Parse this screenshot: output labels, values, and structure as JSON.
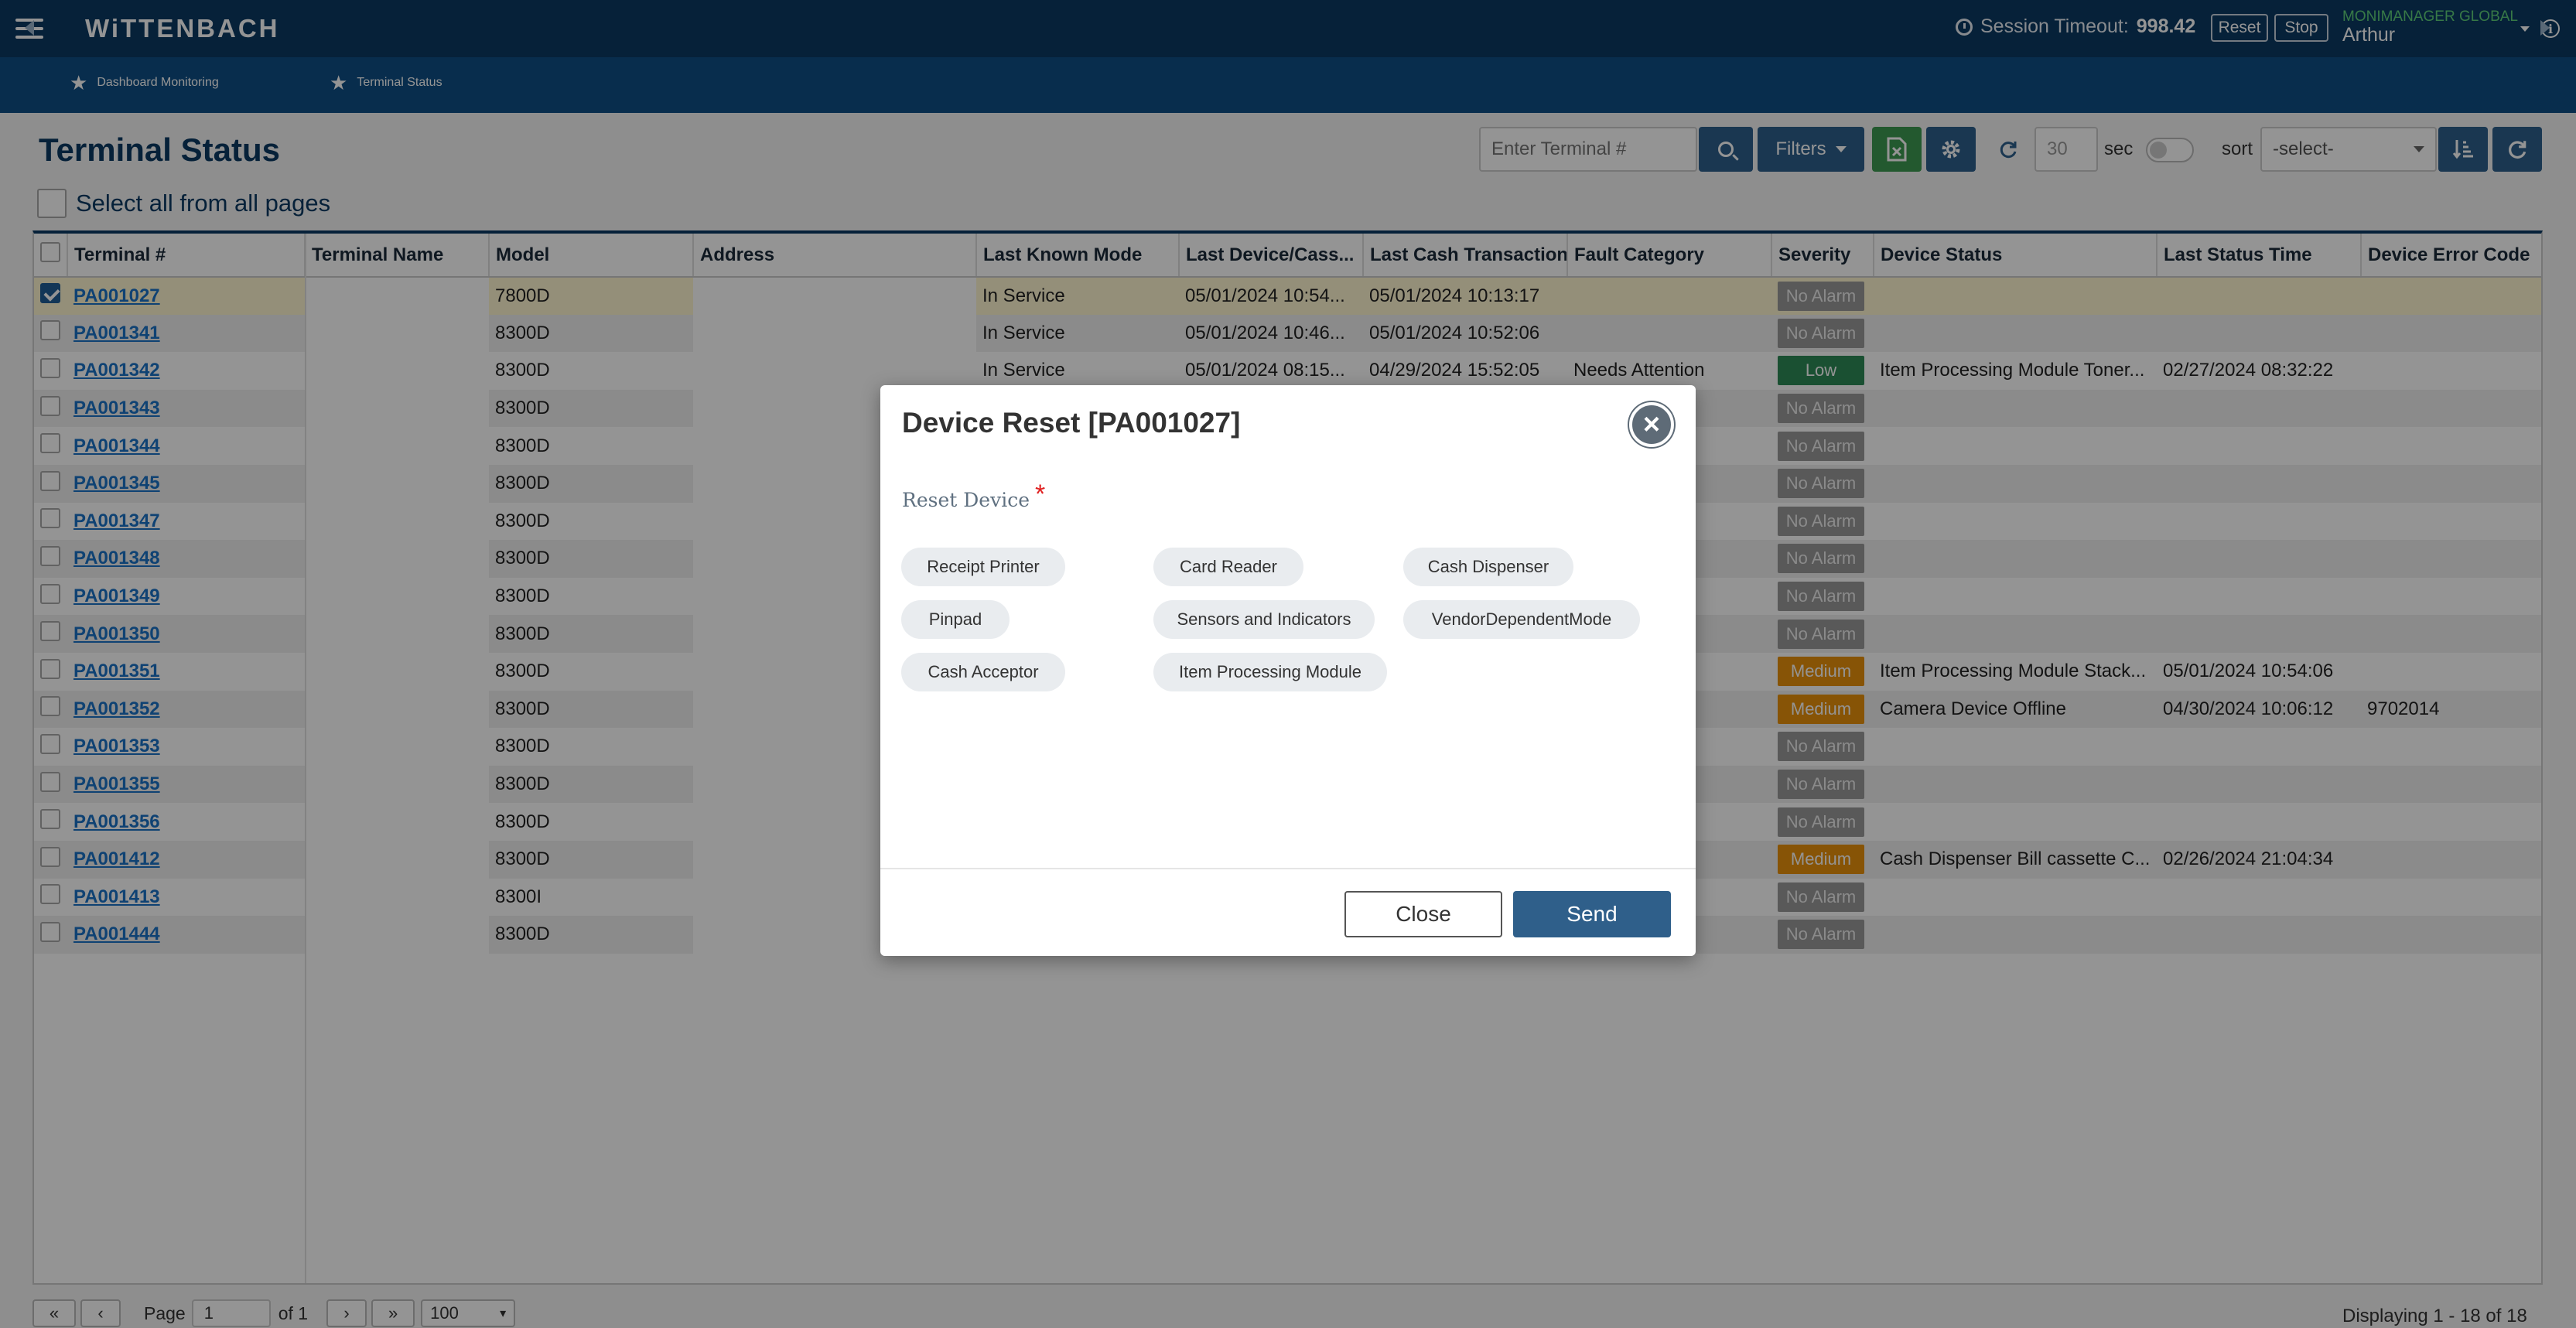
{
  "header": {
    "brand": "WiTTENBACH",
    "session_label": "Session Timeout:",
    "session_value": "998.42",
    "reset_label": "Reset",
    "stop_label": "Stop",
    "org": "MONIMANAGER GLOBAL",
    "user": "Arthur"
  },
  "breadcrumbs": {
    "item1": "Dashboard Monitoring",
    "item2": "Terminal Status"
  },
  "page": {
    "title": "Terminal Status",
    "select_all": "Select all from all pages"
  },
  "toolbar": {
    "terminal_placeholder": "Enter Terminal #",
    "filters_label": "Filters",
    "refresh_value": "30",
    "sec_label": "sec",
    "sort_label": "sort",
    "sort_value": "-select-"
  },
  "table": {
    "columns": [
      "Terminal #",
      "Terminal Name",
      "Model",
      "Address",
      "Last Known Mode",
      "Last Device/Cass...",
      "Last Cash Transaction",
      "Fault Category",
      "Severity",
      "Device Status",
      "Last Status Time",
      "Device Error Code"
    ],
    "rows": [
      {
        "terminal": "PA001027",
        "model": "7800D",
        "mode": "In Service",
        "last_device": "05/01/2024 10:54...",
        "last_cash": "05/01/2024 10:13:17",
        "fault": "",
        "severity": "No Alarm",
        "status": "",
        "status_time": "",
        "error": ""
      },
      {
        "terminal": "PA001341",
        "model": "8300D",
        "mode": "In Service",
        "last_device": "05/01/2024 10:46...",
        "last_cash": "05/01/2024 10:52:06",
        "fault": "",
        "severity": "No Alarm",
        "status": "",
        "status_time": "",
        "error": ""
      },
      {
        "terminal": "PA001342",
        "model": "8300D",
        "mode": "In Service",
        "last_device": "05/01/2024 08:15...",
        "last_cash": "04/29/2024 15:52:05",
        "fault": "Needs Attention",
        "severity": "Low",
        "status": "Item Processing Module Toner...",
        "status_time": "02/27/2024 08:32:22",
        "error": ""
      },
      {
        "terminal": "PA001343",
        "model": "8300D",
        "severity": "No Alarm",
        "status": "",
        "status_time": "",
        "error": ""
      },
      {
        "terminal": "PA001344",
        "model": "8300D",
        "severity": "No Alarm",
        "status": "",
        "status_time": "",
        "error": ""
      },
      {
        "terminal": "PA001345",
        "model": "8300D",
        "severity": "No Alarm",
        "status": "",
        "status_time": "",
        "error": ""
      },
      {
        "terminal": "PA001347",
        "model": "8300D",
        "severity": "No Alarm",
        "status": "",
        "status_time": "",
        "error": ""
      },
      {
        "terminal": "PA001348",
        "model": "8300D",
        "severity": "No Alarm",
        "status": "",
        "status_time": "",
        "error": ""
      },
      {
        "terminal": "PA001349",
        "model": "8300D",
        "severity": "No Alarm",
        "status": "",
        "status_time": "",
        "error": ""
      },
      {
        "terminal": "PA001350",
        "model": "8300D",
        "severity": "No Alarm",
        "status": "",
        "status_time": "",
        "error": ""
      },
      {
        "terminal": "PA001351",
        "model": "8300D",
        "severity": "Medium",
        "status": "Item Processing Module Stack...",
        "status_time": "05/01/2024 10:54:06",
        "error": ""
      },
      {
        "terminal": "PA001352",
        "model": "8300D",
        "severity": "Medium",
        "status": "Camera Device Offline",
        "status_time": "04/30/2024 10:06:12",
        "error": "9702014"
      },
      {
        "terminal": "PA001353",
        "model": "8300D",
        "severity": "No Alarm",
        "status": "",
        "status_time": "",
        "error": ""
      },
      {
        "terminal": "PA001355",
        "model": "8300D",
        "severity": "No Alarm",
        "status": "",
        "status_time": "",
        "error": ""
      },
      {
        "terminal": "PA001356",
        "model": "8300D",
        "severity": "No Alarm",
        "status": "",
        "status_time": "",
        "error": ""
      },
      {
        "terminal": "PA001412",
        "model": "8300D",
        "severity": "Medium",
        "status": "Cash Dispenser Bill cassette C...",
        "status_time": "02/26/2024 21:04:34",
        "error": ""
      },
      {
        "terminal": "PA001413",
        "model": "8300I",
        "severity": "No Alarm",
        "status": "",
        "status_time": "",
        "error": ""
      },
      {
        "terminal": "PA001444",
        "model": "8300D",
        "severity": "No Alarm",
        "status": "",
        "status_time": "",
        "error": ""
      }
    ]
  },
  "pager": {
    "page_label": "Page",
    "page_value": "1",
    "of_label": "of 1",
    "per_page": "100",
    "displaying": "Displaying 1 - 18 of 18"
  },
  "modal": {
    "title": "Device Reset [PA001027]",
    "field_label": "Reset Device",
    "required_mark": "*",
    "chips": {
      "receipt_printer": "Receipt Printer",
      "card_reader": "Card Reader",
      "cash_dispenser": "Cash Dispenser",
      "pinpad": "Pinpad",
      "sensors": "Sensors and Indicators",
      "vendor_mode": "VendorDependentMode",
      "cash_acceptor": "Cash Acceptor",
      "ipm": "Item Processing Module"
    },
    "close_label": "Close",
    "send_label": "Send"
  },
  "colors": {
    "topbar": "#0b3a63",
    "crumbbar": "#0f4f85",
    "severity_none": "#9a9a9a",
    "severity_low": "#2e8b57",
    "severity_medium": "#e8910b",
    "send_button": "#2f5f8a"
  }
}
